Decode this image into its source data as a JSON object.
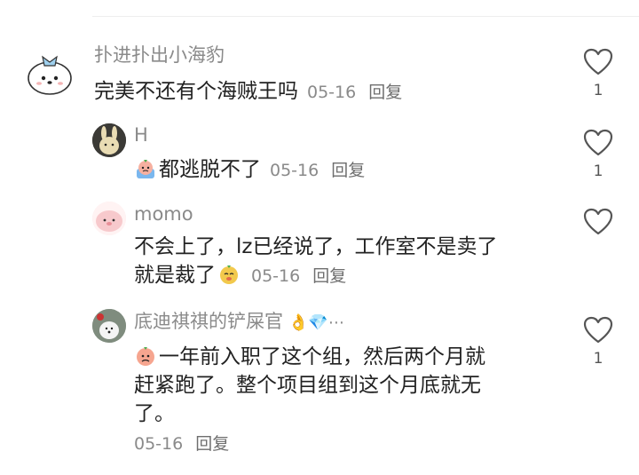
{
  "comments": [
    {
      "author": "扑进扑出小海豹",
      "text": "完美不还有个海贼王吗",
      "date": "05-16",
      "reply": "回复",
      "likes": "1"
    },
    {
      "author": "H",
      "text": "都逃脱不了",
      "date": "05-16",
      "reply": "回复",
      "likes": "1"
    },
    {
      "author": "momo",
      "text_line1": "不会上了，lz已经说了，工作室不是卖了",
      "text_line2": "就是裁了",
      "date": "05-16",
      "reply": "回复",
      "likes": ""
    },
    {
      "author": "底迪祺祺的铲屎官",
      "author_badges": "👌💎⋯",
      "text_line1": "一年前入职了这个组，然后两个月就",
      "text_line2": "赶紧跑了。整个项目组到这个月底就无",
      "text_line3": "了。",
      "date": "05-16",
      "reply": "回复",
      "likes": "1"
    }
  ],
  "icons": {
    "like": "heart-outline-icon",
    "emoji_crying_fruit": "crying-fruit-emoji-icon",
    "emoji_smug_fruit": "smug-fruit-emoji-icon",
    "emoji_upset_fruit": "upset-fruit-emoji-icon"
  },
  "colors": {
    "text": "#222222",
    "muted": "#8a8a8a",
    "divider": "#eeeeee"
  }
}
